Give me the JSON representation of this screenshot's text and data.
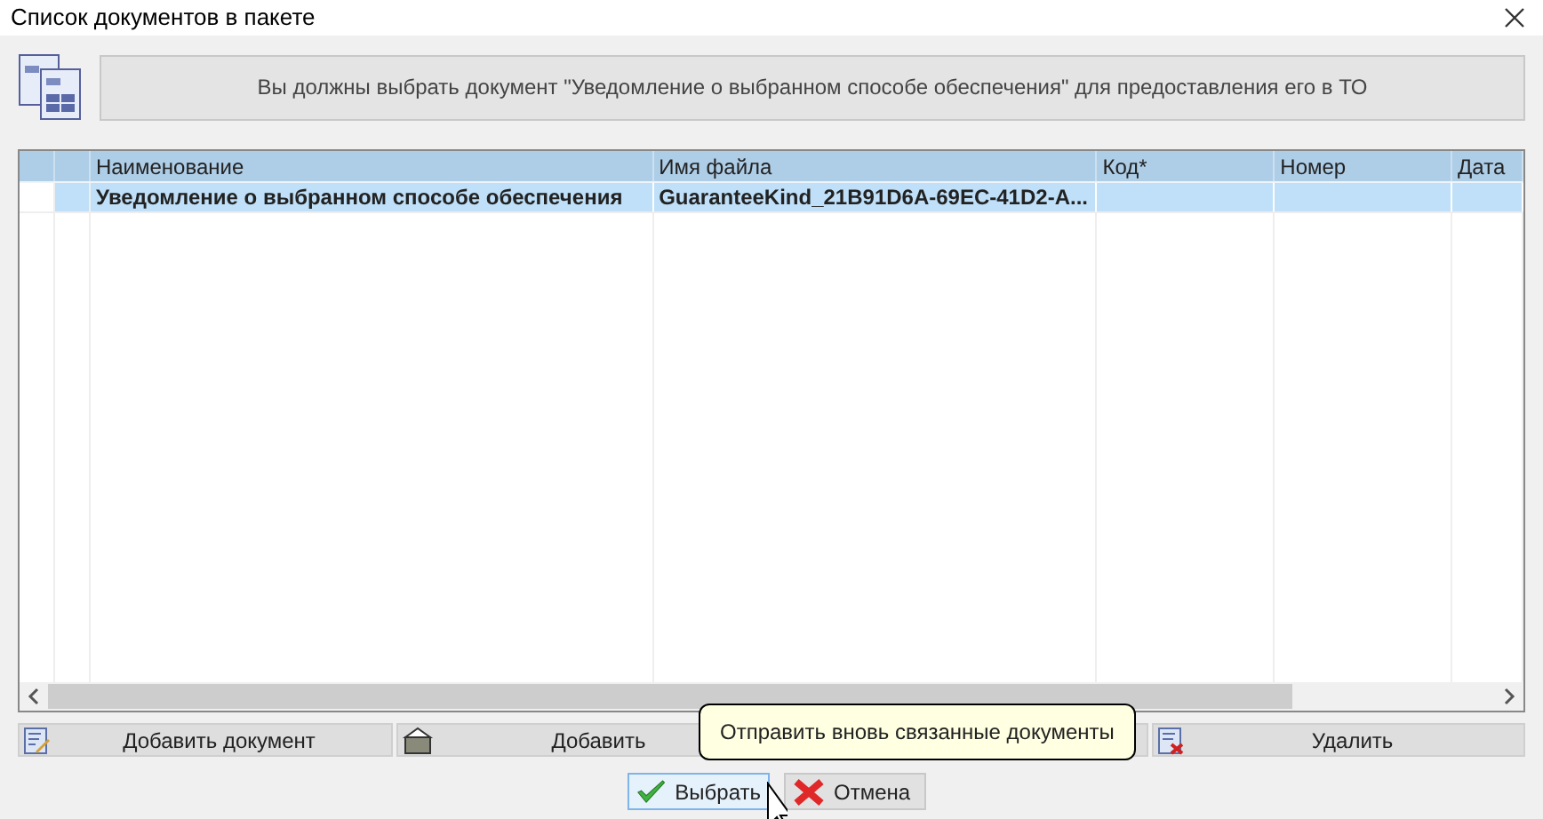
{
  "window": {
    "title": "Список документов в пакете"
  },
  "message": "Вы должны выбрать документ \"Уведомление о выбранном способе обеспечения\" для предоставления его в ТО",
  "table": {
    "columns": [
      "Наименование",
      "Имя файла",
      "Код*",
      "Номер",
      "Дата"
    ],
    "rows": [
      {
        "cells": [
          "Уведомление о выбранном способе обеспечения",
          "GuaranteeKind_21B91D6A-69EC-41D2-A...",
          "",
          "",
          ""
        ],
        "selected": true
      }
    ]
  },
  "toolbar": [
    {
      "kind": "doc",
      "label": "Добавить документ"
    },
    {
      "kind": "box",
      "label": "Добавить"
    },
    {
      "kind": "hidden"
    },
    {
      "kind": "delete",
      "label": "Удалить"
    }
  ],
  "tooltip": "Отправить вновь связанные документы",
  "buttons": [
    {
      "kind": "ok",
      "label": "Выбрать",
      "hover": true
    },
    {
      "kind": "cancel",
      "label": "Отмена",
      "hover": false
    }
  ]
}
